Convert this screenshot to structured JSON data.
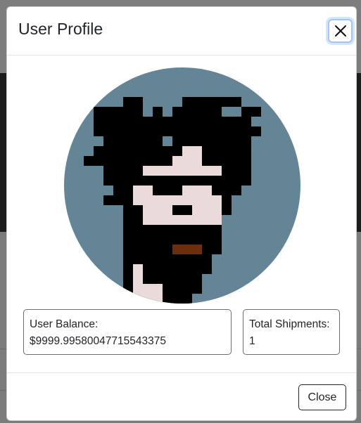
{
  "modal": {
    "title": "User Profile",
    "close_icon": "close-icon",
    "avatar_alt": "pixel avatar",
    "balance_label": "User Balance:",
    "balance_value": "$9999.99580047715543375",
    "shipments_label": "Total Shipments:",
    "shipments_value": "1",
    "footer_close_label": "Close"
  },
  "colors": {
    "avatar_background": "#638596",
    "skin": "#eadada",
    "hair": "#000000",
    "mouth": "#6b2f0e",
    "focus_ring": "#9ec5fe"
  }
}
